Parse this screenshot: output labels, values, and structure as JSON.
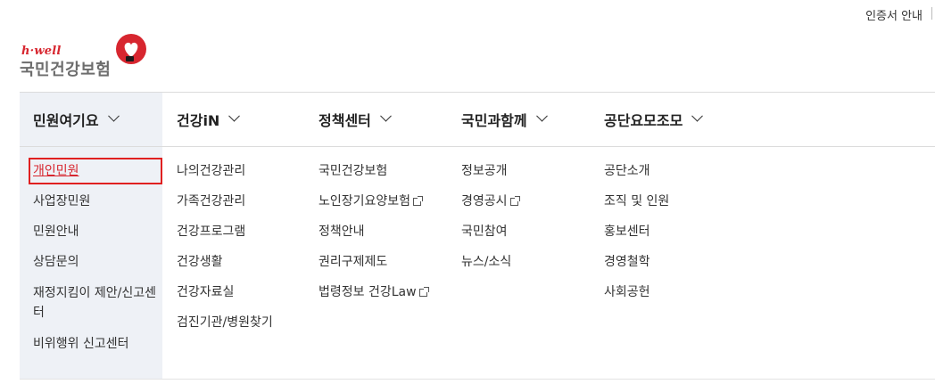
{
  "topbar": {
    "cert_label": "인증서 안내"
  },
  "logo": {
    "sub": "h·well",
    "main": "국민건강보험"
  },
  "gnb": {
    "tabs": [
      {
        "label": "민원여기요"
      },
      {
        "label": "건강iN"
      },
      {
        "label": "정책센터"
      },
      {
        "label": "국민과함께"
      },
      {
        "label": "공단요모조모"
      }
    ]
  },
  "columns": [
    {
      "items": [
        "개인민원",
        "사업장민원",
        "민원안내",
        "상담문의",
        "재정지킴이 제안/신고센터",
        "비위행위 신고센터"
      ]
    },
    {
      "items": [
        "나의건강관리",
        "가족건강관리",
        "건강프로그램",
        "건강생활",
        "건강자료실",
        "검진기관/병원찾기"
      ]
    },
    {
      "items": [
        "국민건강보험",
        "노인장기요양보험",
        "정책안내",
        "권리구제제도",
        "법령정보 건강Law"
      ]
    },
    {
      "items": [
        "정보공개",
        "경영공시",
        "국민참여",
        "뉴스/소식"
      ]
    },
    {
      "items": [
        "공단소개",
        "조직 및 인원",
        "홍보센터",
        "경영철학",
        "사회공헌"
      ]
    }
  ],
  "colors": {
    "brand_red": "#d7262f",
    "menu_bg": "#eef1f6"
  }
}
